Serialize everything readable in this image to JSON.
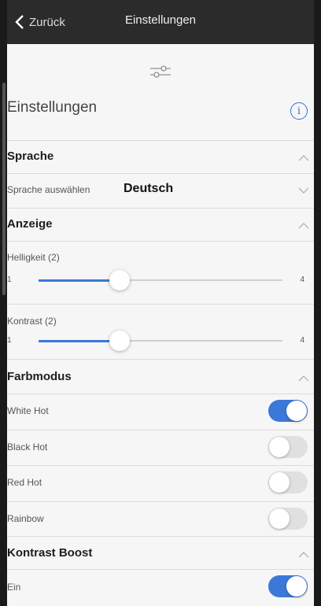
{
  "nav": {
    "back_label": "Zurück",
    "title": "Einstellungen"
  },
  "page": {
    "title": "Einstellungen",
    "info_glyph": "i"
  },
  "sections": {
    "language": {
      "title": "Sprache",
      "select_label": "Sprache auswählen",
      "selected": "Deutsch"
    },
    "display": {
      "title": "Anzeige",
      "brightness": {
        "label": "Helligkeit (2)",
        "min": "1",
        "max": "4",
        "value": 2
      },
      "contrast": {
        "label": "Kontrast (2)",
        "min": "1",
        "max": "4",
        "value": 2
      }
    },
    "color_mode": {
      "title": "Farbmodus",
      "options": [
        {
          "label": "White Hot",
          "on": true
        },
        {
          "label": "Black Hot",
          "on": false
        },
        {
          "label": "Red Hot",
          "on": false
        },
        {
          "label": "Rainbow",
          "on": false
        }
      ]
    },
    "contrast_boost": {
      "title": "Kontrast Boost",
      "option": {
        "label": "Ein",
        "on": true
      }
    }
  },
  "colors": {
    "accent": "#3c78d8",
    "navbar": "#2b2b2b",
    "background": "#f6f6f6"
  }
}
